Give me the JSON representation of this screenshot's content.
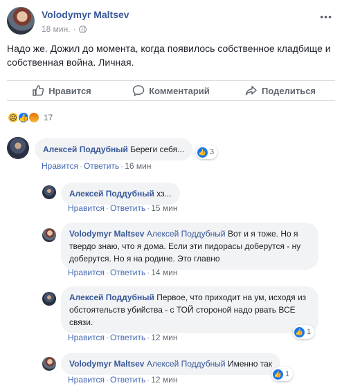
{
  "post": {
    "author": "Volodymyr Maltsev",
    "time": "18 мин.",
    "more": "•••",
    "text": "Надо же. Дожил до момента, когда появилось собственное кладбище и собственная война. Личная."
  },
  "actions": {
    "like": "Нравится",
    "comment": "Комментарий",
    "share": "Поделиться"
  },
  "reactions": {
    "types": [
      "sad",
      "like",
      "angry"
    ],
    "count": "17"
  },
  "sub_labels": {
    "like": "Нравится",
    "reply": "Ответить",
    "dot": "·"
  },
  "comments": [
    {
      "author": "Алексей Поддубный",
      "tag": "",
      "text": "Береги себя...",
      "time": "16 мин",
      "likes": "3"
    },
    {
      "author": "Алексей Поддубный",
      "tag": "",
      "text": "хз...",
      "time": "15 мин",
      "likes": ""
    },
    {
      "author": "Volodymyr Maltsev",
      "tag": "Алексей Поддубный",
      "text": "Вот и я тоже. Но я твердо знаю, что я дома. Если эти пидорасы доберутся - ну доберутся. Но я на родине. Это главно",
      "time": "14 мин",
      "likes": ""
    },
    {
      "author": "Алексей Поддубный",
      "tag": "",
      "text": "Первое, что приходит на ум, исходя из обстоятельств убийства - с ТОЙ стороной надо рвать ВСЕ связи.",
      "time": "12 мин",
      "likes": "1"
    },
    {
      "author": "Volodymyr Maltsev",
      "tag": "Алексей Поддубный",
      "text": "Именно так",
      "time": "12 мин",
      "likes": "1"
    }
  ],
  "colors": {
    "link": "#385898",
    "action_link": "#4267b2",
    "muted": "#606770",
    "bubble_bg": "#f2f3f5",
    "like_blue": "#1877f2"
  }
}
